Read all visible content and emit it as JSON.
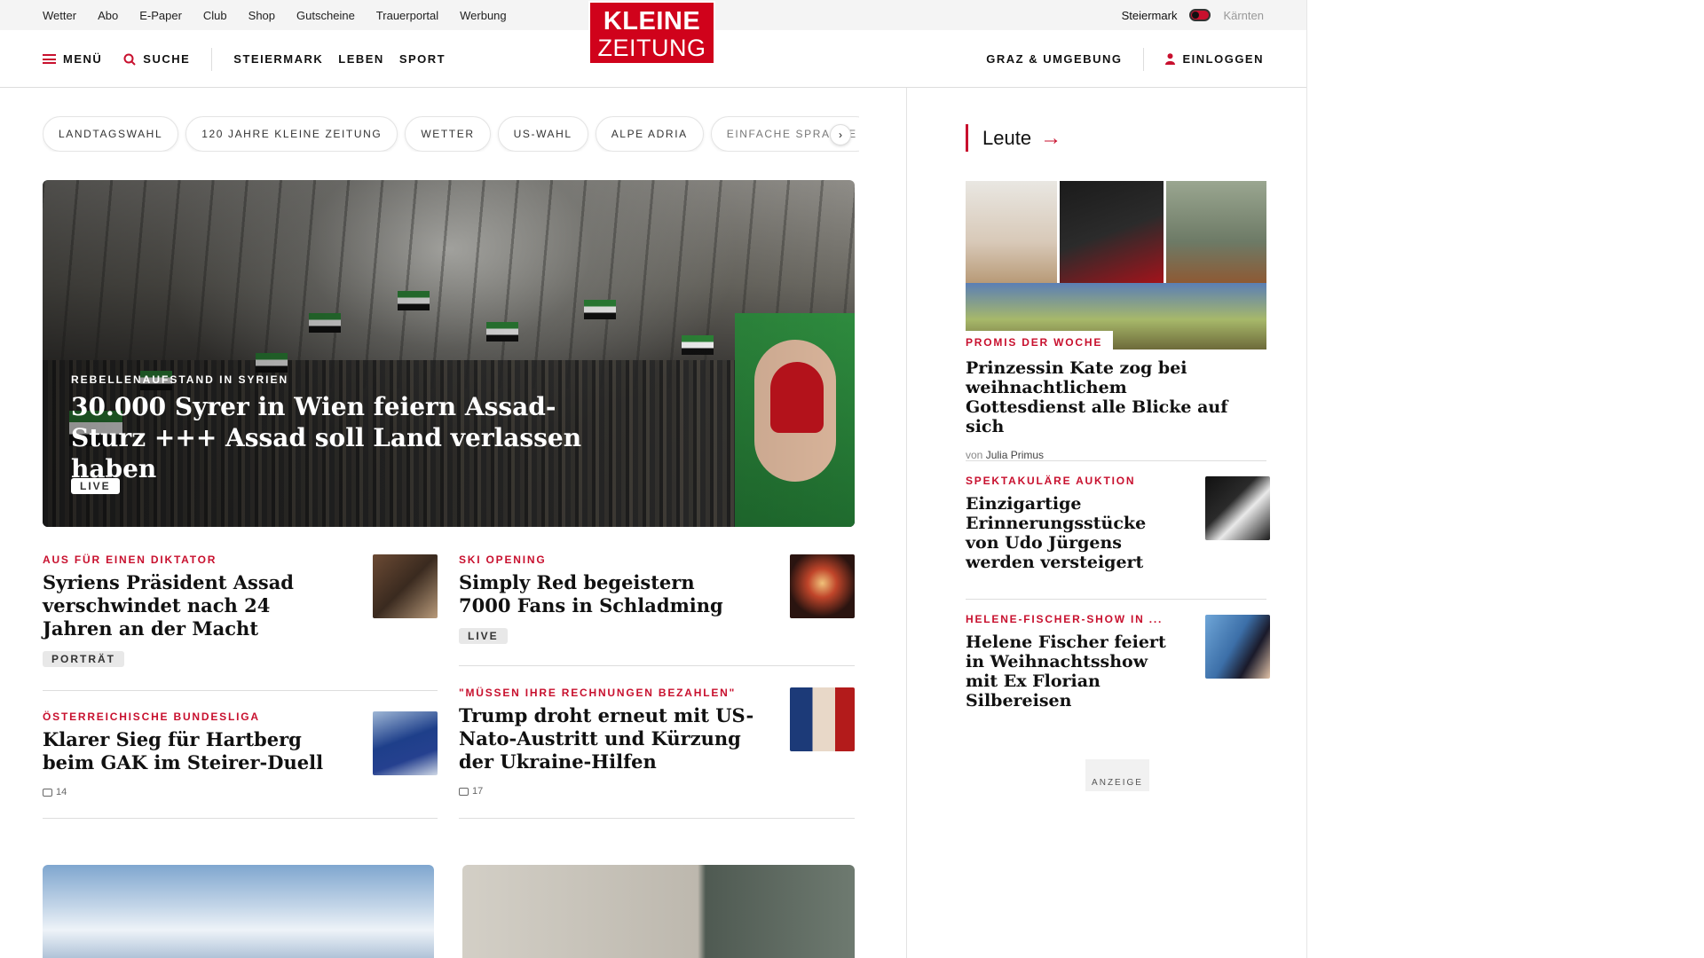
{
  "topbar": {
    "links": [
      "Wetter",
      "Abo",
      "E-Paper",
      "Club",
      "Shop",
      "Gutscheine",
      "Trauerportal",
      "Werbung"
    ],
    "region_active": "Steiermark",
    "region_inactive": "Kärnten"
  },
  "header": {
    "menu_label": "MENÜ",
    "search_label": "SUCHE",
    "nav": [
      "STEIERMARK",
      "LEBEN",
      "SPORT"
    ],
    "logo_line1": "KLEINE",
    "logo_line2": "ZEITUNG",
    "location_label": "GRAZ & UMGEBUNG",
    "login_label": "EINLOGGEN"
  },
  "pills": [
    "LANDTAGSWAHL",
    "120 JAHRE KLEINE ZEITUNG",
    "WETTER",
    "US-WAHL",
    "ALPE ADRIA",
    "EINFACHE SPRACHE"
  ],
  "pills_next": "›",
  "hero": {
    "kicker": "REBELLENAUFSTAND IN SYRIEN",
    "title": "30.000 Syrer in Wien feiern Assad-Sturz +++ Assad soll Land verlassen haben",
    "badge": "LIVE"
  },
  "teasers": [
    {
      "kicker": "AUS FÜR EINEN DIKTATOR",
      "title": "Syriens Präsident Assad verschwindet nach 24 Jahren an der Macht",
      "badge": "PORTRÄT"
    },
    {
      "kicker": "SKI OPENING",
      "title": "Simply Red begeistern 7000 Fans in Schladming",
      "badge": "LIVE"
    },
    {
      "kicker": "ÖSTERREICHISCHE BUNDESLIGA",
      "title": "Klarer Sieg für Hartberg beim GAK im Steirer-Duell",
      "comments": "14"
    },
    {
      "kicker": "\"MÜSSEN IHRE RECHNUNGEN BEZAHLEN\"",
      "title": "Trump droht erneut mit US-Nato-Austritt und Kürzung der Ukraine-Hilfen",
      "comments": "17"
    }
  ],
  "sidebar": {
    "section_title": "Leute",
    "arrow": "→",
    "main": {
      "kicker": "PROMIS DER WOCHE",
      "title": "Prinzessin Kate zog bei weihnachtlichem Gottesdienst alle Blicke auf sich",
      "by": "von",
      "author": "Julia Primus"
    },
    "items": [
      {
        "kicker": "SPEKTAKULÄRE AUKTION",
        "title": "Einzigartige Erinnerungsstücke von Udo Jürgens werden versteigert"
      },
      {
        "kicker": "HELENE-FISCHER-SHOW IN ...",
        "title": "Helene Fischer feiert in Weihnachtsshow mit Ex Florian Silbereisen"
      }
    ],
    "ad_label": "ANZEIGE"
  },
  "colors": {
    "accent": "#c8102e",
    "logo": "#d0021b",
    "topbar_bg": "#f4f4f4"
  }
}
